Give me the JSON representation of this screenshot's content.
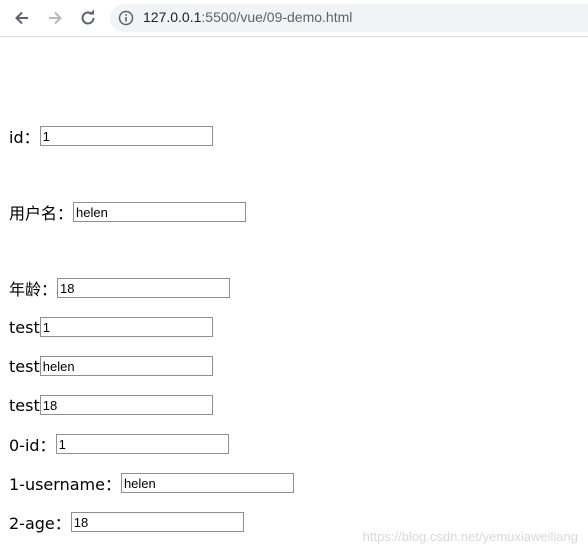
{
  "browser": {
    "url_host": "127.0.0.1",
    "url_path": ":5500/vue/09-demo.html"
  },
  "form": {
    "id": {
      "label": "id：",
      "value": "1"
    },
    "username": {
      "label": "用户名：",
      "value": "helen"
    },
    "age": {
      "label": "年龄：",
      "value": "18"
    },
    "tests": [
      {
        "label": "test",
        "value": "1"
      },
      {
        "label": "test",
        "value": "helen"
      },
      {
        "label": "test",
        "value": "18"
      }
    ],
    "indexed": [
      {
        "label": "0-id：",
        "value": "1"
      },
      {
        "label": "1-username：",
        "value": "helen"
      },
      {
        "label": "2-age：",
        "value": "18"
      }
    ]
  },
  "watermark": "https://blog.csdn.net/yemuxiaweiliang"
}
